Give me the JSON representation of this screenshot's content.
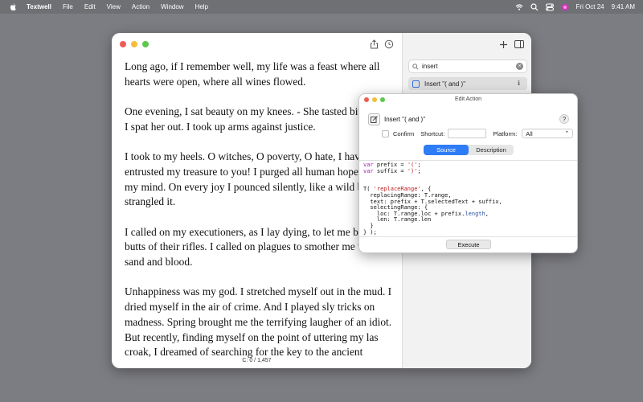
{
  "menubar": {
    "app_name": "Textwell",
    "items": [
      "File",
      "Edit",
      "View",
      "Action",
      "Window",
      "Help"
    ],
    "date": "Fri Oct 24",
    "time": "9:41 AM"
  },
  "document": {
    "paragraphs": [
      "Long ago, if I remember well, my life was a feast where all hearts were open, where all wines flowed.",
      "One evening, I sat beauty on my knees. - She tasted bitter. And I spat her out. I took up arms against justice.",
      "I took to my heels. O witches, O poverty, O hate, I have entrusted my treasure to you! I purged all human hope from my mind. On every joy I pounced silently, like a wild beast and strangled it.",
      "I called on my executioners, as I lay dying, to let me bite the butts of their rifles. I called on plagues to smother me with sand and blood.",
      "Unhappiness was my god. I stretched myself out in the mud. I dried myself in the air of crime. And I played sly tricks on madness. Spring brought me the terrifying laugher of an idiot. But recently, finding myself on the point of uttering my las croak, I dreamed of searching for the key to the ancient"
    ],
    "status": "C: 0 / 1,457"
  },
  "sidebar": {
    "search_value": "insert",
    "items": [
      {
        "label": "Insert \"( and )\""
      }
    ]
  },
  "edit_action": {
    "title": "Edit Action",
    "name": "Insert \"( and )\"",
    "confirm_label": "Confirm",
    "shortcut_label": "Shortcut:",
    "platform_label": "Platform:",
    "platform_value": "All",
    "tabs": [
      "Source",
      "Description"
    ],
    "execute_label": "Execute"
  }
}
